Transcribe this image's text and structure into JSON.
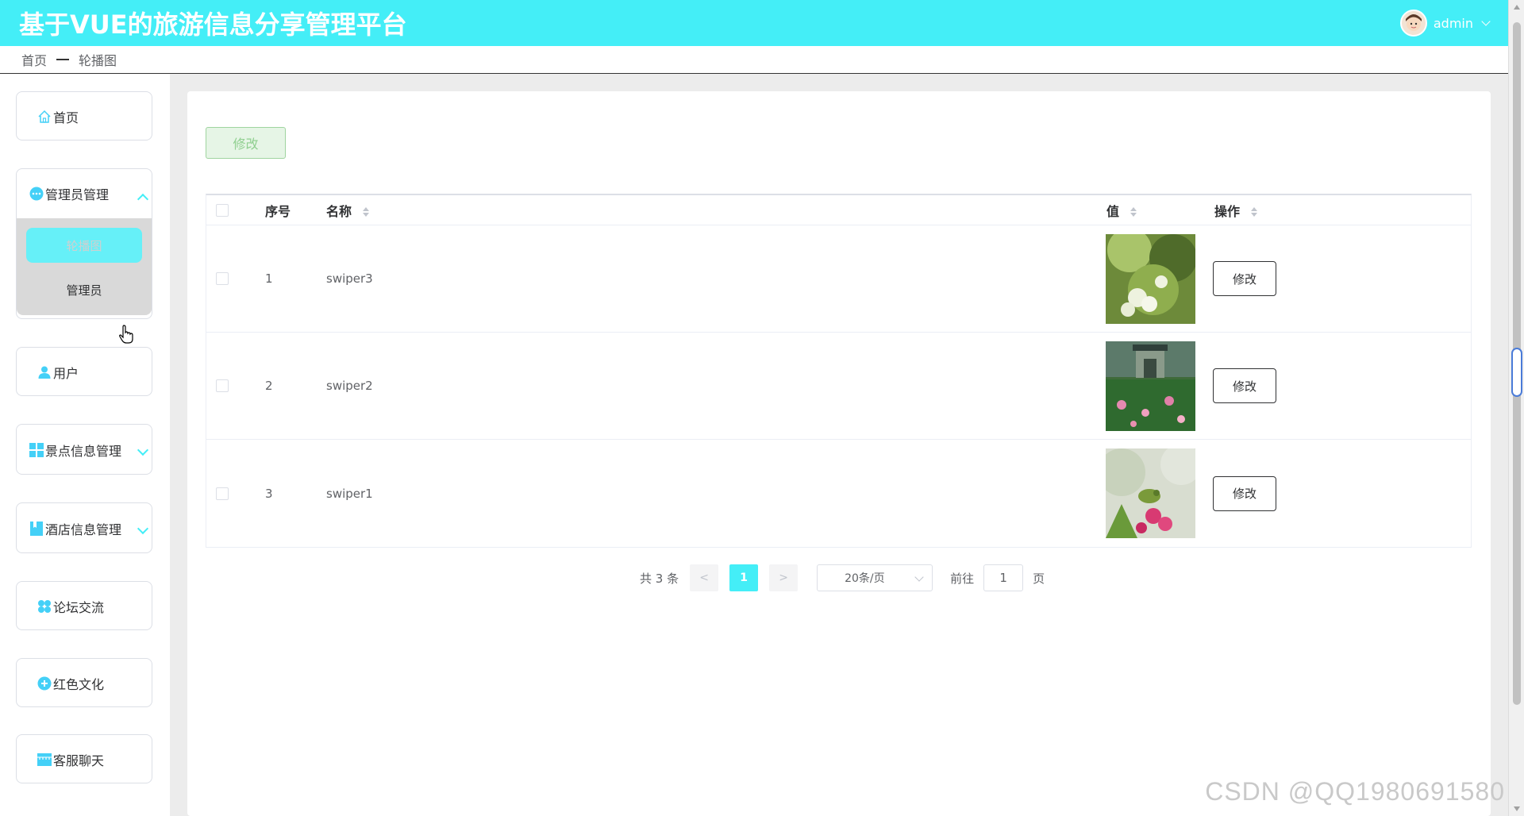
{
  "header": {
    "title": "基于VUE的旅游信息分享管理平台",
    "username": "admin",
    "accent_color": "#44eef7"
  },
  "breadcrumb": {
    "home": "首页",
    "current": "轮播图"
  },
  "sidebar": {
    "items": [
      {
        "label": "首页",
        "icon": "home-icon"
      },
      {
        "label": "管理员管理",
        "icon": "more-dots-icon",
        "expanded": true,
        "children": [
          {
            "label": "轮播图",
            "active": true
          },
          {
            "label": "管理员"
          }
        ]
      },
      {
        "label": "用户",
        "icon": "user-icon"
      },
      {
        "label": "景点信息管理",
        "icon": "grid-icon"
      },
      {
        "label": "酒店信息管理",
        "icon": "bookmark-icon"
      },
      {
        "label": "论坛交流",
        "icon": "flower-icon"
      },
      {
        "label": "红色文化",
        "icon": "plus-circle-icon"
      },
      {
        "label": "客服聊天",
        "icon": "shop-icon"
      }
    ]
  },
  "toolbar": {
    "edit_label": "修改"
  },
  "table": {
    "columns": [
      "序号",
      "名称",
      "值",
      "操作"
    ],
    "rows": [
      {
        "index": "1",
        "name": "swiper3",
        "action": "修改"
      },
      {
        "index": "2",
        "name": "swiper2",
        "action": "修改"
      },
      {
        "index": "3",
        "name": "swiper1",
        "action": "修改"
      }
    ]
  },
  "pagination": {
    "total_text": "共 3 条",
    "prev": "<",
    "current_page": "1",
    "next": ">",
    "page_size": "20条/页",
    "goto_label": "前往",
    "goto_value": "1",
    "page_suffix": "页"
  },
  "watermark": "CSDN @QQ1980691580"
}
